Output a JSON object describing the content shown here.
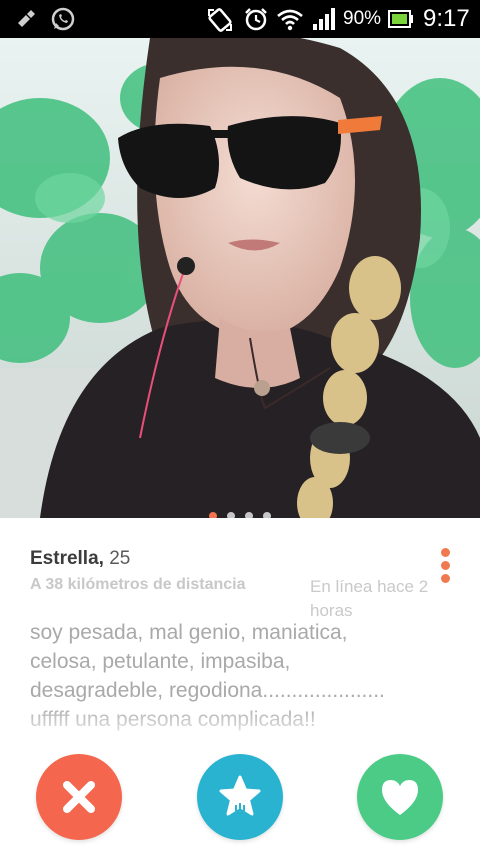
{
  "status_bar": {
    "battery_percent": "90%",
    "time": "9:17",
    "icons": [
      "usb-debug-icon",
      "whatsapp-icon",
      "auto-rotate-icon",
      "alarm-icon",
      "wifi-icon",
      "signal-icon",
      "battery-icon"
    ]
  },
  "photo": {
    "page_count": 4,
    "active_page": 1
  },
  "profile": {
    "name": "Estrella,",
    "age": "25",
    "distance": "A 38 kilómetros de distancia",
    "last_online": "En línea hace 2 horas",
    "bio_lines": [
      "soy pesada, mal genio, maniatica,",
      "celosa, petulante, impasiba,",
      "desagradeble, regodiona.....................",
      "ufffff una persona complicada!!"
    ]
  },
  "actions": {
    "nope_icon": "close-icon",
    "superlike_icon": "star-icon",
    "like_icon": "heart-icon"
  },
  "colors": {
    "accent_orange": "#f07a4f",
    "nope": "#f4664d",
    "superlike": "#2ab3d0",
    "like": "#4ccb86"
  }
}
